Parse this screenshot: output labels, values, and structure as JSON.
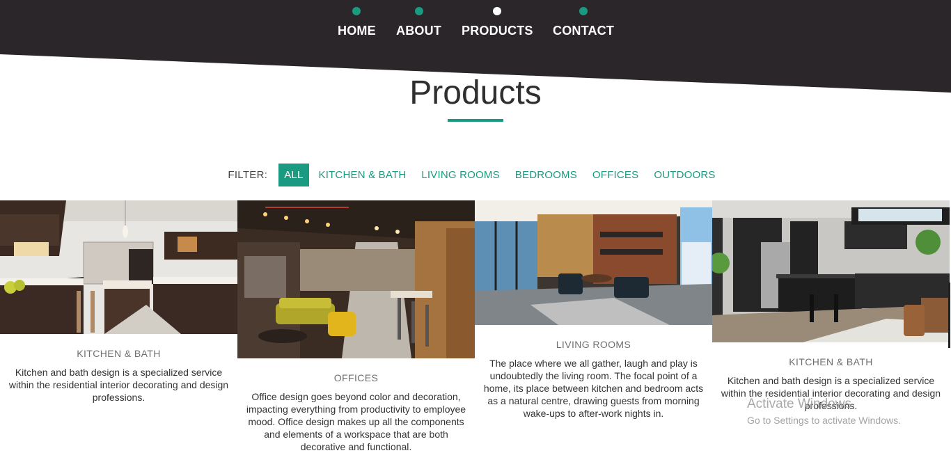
{
  "nav": {
    "items": [
      {
        "label": "HOME",
        "active": false
      },
      {
        "label": "ABOUT",
        "active": false
      },
      {
        "label": "PRODUCTS",
        "active": true
      },
      {
        "label": "CONTACT",
        "active": false
      }
    ]
  },
  "page": {
    "title": "Products"
  },
  "filter": {
    "label": "FILTER:",
    "items": [
      "ALL",
      "KITCHEN & BATH",
      "LIVING ROOMS",
      "BEDROOMS",
      "OFFICES",
      "OUTDOORS"
    ],
    "active": "ALL"
  },
  "cards": [
    {
      "title": "KITCHEN & BATH",
      "description": "Kitchen and bath design is a specialized service within the residential interior decorating and design professions.",
      "image": "kitchen-photo"
    },
    {
      "title": "OFFICES",
      "description": "Office design goes beyond color and decoration, impacting everything from productivity to employee mood. Office design makes up all the components and elements of a workspace that are both decorative and functional.",
      "image": "office-lounge-photo"
    },
    {
      "title": "LIVING ROOMS",
      "description": "The place where we all gather, laugh and play is undoubtedly the living room. The focal point of a home, its place between kitchen and bedroom acts as a natural centre, drawing guests from morning wake-ups to after-work nights in.",
      "image": "living-room-photo"
    },
    {
      "title": "KITCHEN & BATH",
      "description": "Kitchen and bath design is a specialized service within the residential interior decorating and design professions.",
      "image": "dark-kitchen-photo"
    }
  ],
  "watermark": {
    "title": "Activate Windows",
    "subtitle": "Go to Settings to activate Windows."
  },
  "colors": {
    "accent": "#1a9a80",
    "header": "#2a2629"
  }
}
